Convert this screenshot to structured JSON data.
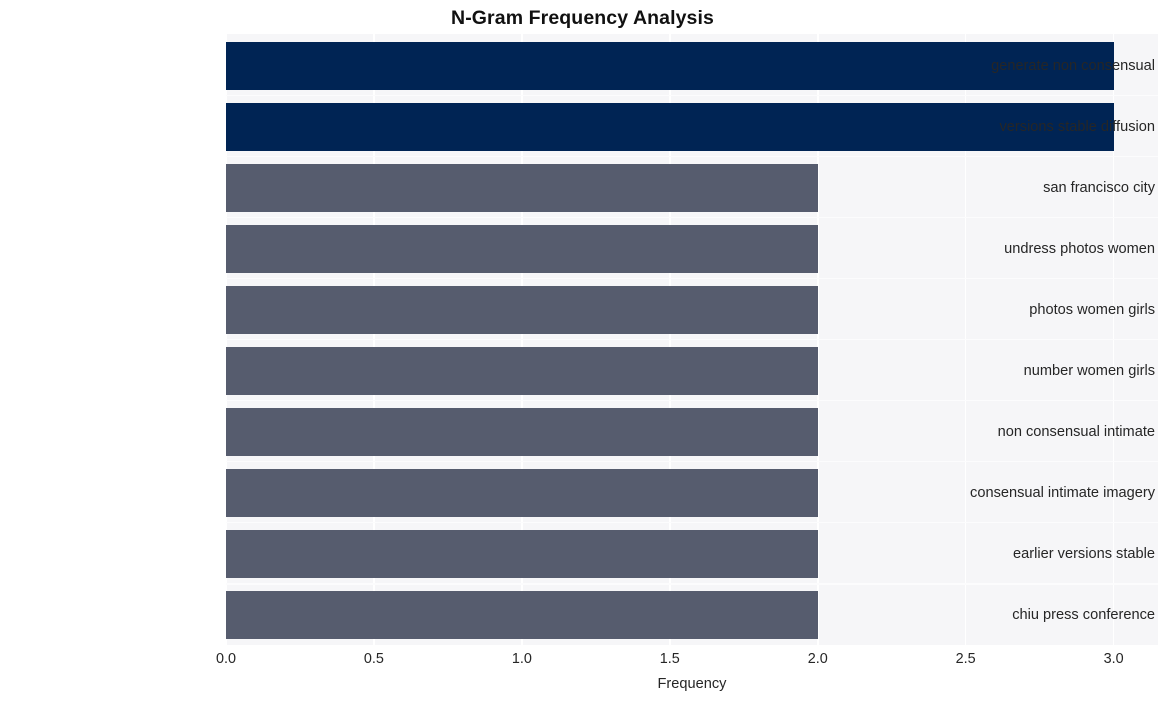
{
  "chart_data": {
    "type": "bar",
    "orientation": "horizontal",
    "title": "N-Gram Frequency Analysis",
    "xlabel": "Frequency",
    "ylabel": "",
    "categories": [
      "generate non consensual",
      "versions stable diffusion",
      "san francisco city",
      "undress photos women",
      "photos women girls",
      "number women girls",
      "non consensual intimate",
      "consensual intimate imagery",
      "earlier versions stable",
      "chiu press conference"
    ],
    "values": [
      3,
      3,
      2,
      2,
      2,
      2,
      2,
      2,
      2,
      2
    ],
    "bar_colors": [
      "#002454",
      "#002454",
      "#565c6e",
      "#565c6e",
      "#565c6e",
      "#565c6e",
      "#565c6e",
      "#565c6e",
      "#565c6e",
      "#565c6e"
    ],
    "xlim": [
      0.0,
      3.15
    ],
    "xticks": [
      0.0,
      0.5,
      1.0,
      1.5,
      2.0,
      2.5,
      3.0
    ],
    "xtick_labels": [
      "0.0",
      "0.5",
      "1.0",
      "1.5",
      "2.0",
      "2.5",
      "3.0"
    ],
    "grid": true,
    "grid_color": "#ffffff",
    "plot_background": "#f6f6f8",
    "figure_background": "#ffffff",
    "legend": null
  },
  "colors": {
    "accent_high": "#002454",
    "accent_low": "#565c6e",
    "text": "#262626",
    "title": "#111111"
  }
}
